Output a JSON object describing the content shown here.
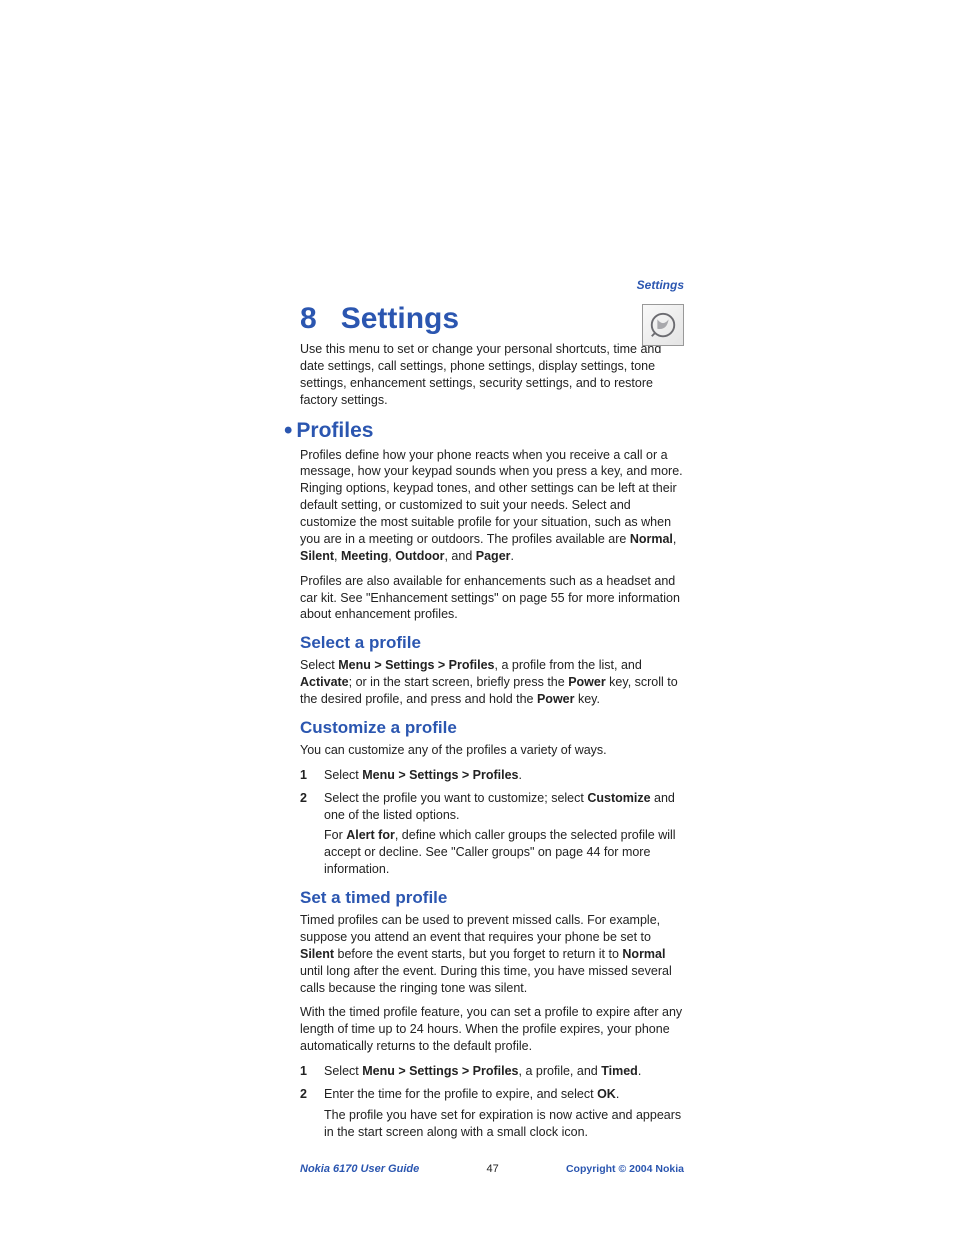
{
  "header": {
    "crumb": "Settings"
  },
  "chapter": {
    "number": "8",
    "title": "Settings"
  },
  "intro": "Use this menu to set or change your personal shortcuts, time and date settings, call settings, phone settings, display settings, tone settings, enhancement settings, security settings, and to restore factory settings.",
  "profiles": {
    "heading": "Profiles",
    "p1a": "Profiles define how your phone reacts when you receive a call or a message, how your keypad sounds when you press a key, and more. Ringing options, keypad tones, and other settings can be left at their default setting, or customized to suit your needs. Select and customize the most suitable profile for your situation, such as when you are in a meeting or outdoors. The profiles available are ",
    "names": {
      "normal": "Normal",
      "silent": "Silent",
      "meeting": "Meeting",
      "outdoor": "Outdoor",
      "pager": "Pager"
    },
    "comma": ", ",
    "and": ", and ",
    "period": ".",
    "p2": "Profiles are also available for enhancements such as a headset and car kit. See \"Enhancement settings\" on page 55 for more information about enhancement profiles."
  },
  "select": {
    "heading": "Select a profile",
    "p1_pre": "Select ",
    "p1_menu": "Menu > Settings > Profiles",
    "p1_mid1": ", a profile from the list, and ",
    "p1_activate": "Activate",
    "p1_mid2": "; or in the start screen, briefly press the ",
    "p1_power1": "Power",
    "p1_mid3": " key, scroll to the desired profile, and press and hold the ",
    "p1_power2": "Power",
    "p1_end": " key."
  },
  "customize": {
    "heading": "Customize a profile",
    "intro": "You can customize any of the profiles a variety of ways.",
    "s1_pre": "Select ",
    "s1_menu": "Menu > Settings > Profiles",
    "s1_end": ".",
    "s2_pre": "Select the profile you want to customize; select ",
    "s2_custom": "Customize",
    "s2_end": " and one of the listed options.",
    "s2b_pre": "For ",
    "s2b_alert": "Alert for",
    "s2b_end": ", define which caller groups the selected profile will accept or decline. See \"Caller groups\" on page 44 for more information."
  },
  "timed": {
    "heading": "Set a timed profile",
    "p1_pre": "Timed profiles can be used to prevent missed calls. For example, suppose you attend an event that requires your phone be set to ",
    "p1_silent": "Silent",
    "p1_mid": " before the event starts, but you forget to return it to ",
    "p1_normal": "Normal",
    "p1_end": " until long after the event. During this time, you have missed several calls because the ringing tone was silent.",
    "p2": "With the timed profile feature, you can set a profile to expire after any length of time up to 24 hours. When the profile expires, your phone automatically returns to the default profile.",
    "s1_pre": "Select ",
    "s1_menu": "Menu > Settings > Profiles",
    "s1_mid": ", a profile, and ",
    "s1_timed": "Timed",
    "s1_end": ".",
    "s2_pre": "Enter the time for the profile to expire, and select ",
    "s2_ok": "OK",
    "s2_end": ".",
    "s2b": "The profile you have set for expiration is now active and appears in the start screen along with a small clock icon."
  },
  "footer": {
    "left": "Nokia 6170 User Guide",
    "page": "47",
    "right": "Copyright © 2004 Nokia"
  }
}
